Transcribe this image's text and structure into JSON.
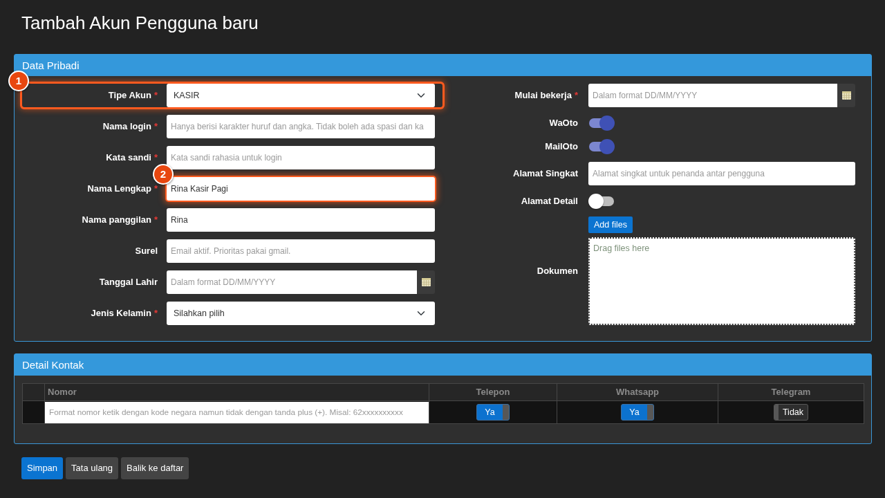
{
  "page_title": "Tambah Akun Pengguna baru",
  "personal_panel": {
    "title": "Data Pribadi",
    "left_fields": [
      {
        "kind": "select",
        "label": "Tipe Akun",
        "required_mark": "*",
        "value": "KASIR",
        "callout": {
          "number": "1",
          "kind": "row"
        }
      },
      {
        "kind": "text",
        "label": "Nama login",
        "required_mark": "*",
        "placeholder": "Hanya berisi karakter huruf dan angka. Tidak boleh ada spasi dan ka"
      },
      {
        "kind": "text",
        "label": "Kata sandi",
        "required_mark": "*",
        "placeholder": "Kata sandi rahasia untuk login"
      },
      {
        "kind": "text",
        "label": "Nama Lengkap",
        "required_mark": "*",
        "value": "Rina Kasir Pagi",
        "callout": {
          "number": "2",
          "kind": "field"
        }
      },
      {
        "kind": "text",
        "label": "Nama panggilan",
        "required_mark": "*",
        "value": "Rina"
      },
      {
        "kind": "text",
        "label": "Surel",
        "placeholder": "Email aktif. Prioritas pakai gmail."
      },
      {
        "kind": "date",
        "label": "Tanggal Lahir",
        "placeholder": "Dalam format DD/MM/YYYY"
      },
      {
        "kind": "select",
        "label": "Jenis Kelamin",
        "required_mark": "*",
        "value": "Silahkan pilih"
      }
    ],
    "right_fields": [
      {
        "kind": "date",
        "label": "Mulai bekerja",
        "required_mark": "*",
        "placeholder": "Dalam format DD/MM/YYYY"
      },
      {
        "kind": "toggle",
        "label": "WaOto",
        "on": true
      },
      {
        "kind": "toggle",
        "label": "MailOto",
        "on": true
      },
      {
        "kind": "text",
        "label": "Alamat Singkat",
        "placeholder": "Alamat singkat untuk penanda antar pengguna"
      },
      {
        "kind": "toggle",
        "label": "Alamat Detail",
        "on": false
      },
      {
        "kind": "file",
        "label": "Dokumen",
        "button": "Add files",
        "drop_hint": "Drag files here"
      }
    ]
  },
  "contact_panel": {
    "title": "Detail Kontak",
    "table": {
      "columns": [
        "Nomor",
        "Telepon",
        "Whatsapp",
        "Telegram"
      ],
      "rows": [
        {
          "cells": [
            {
              "kind": "input",
              "placeholder": "Format nomor ketik dengan kode negara namun tidak dengan tanda plus (+). Misal: 62xxxxxxxxxx"
            },
            {
              "kind": "switch",
              "on": true,
              "label": "Ya"
            },
            {
              "kind": "switch",
              "on": true,
              "label": "Ya"
            },
            {
              "kind": "switch",
              "on": false,
              "label": "Tidak"
            }
          ]
        }
      ]
    }
  },
  "buttons": [
    {
      "label": "Simpan",
      "kind": "primary"
    },
    {
      "label": "Tata ulang",
      "kind": "secondary"
    },
    {
      "label": "Balik ke daftar",
      "kind": "secondary"
    }
  ]
}
